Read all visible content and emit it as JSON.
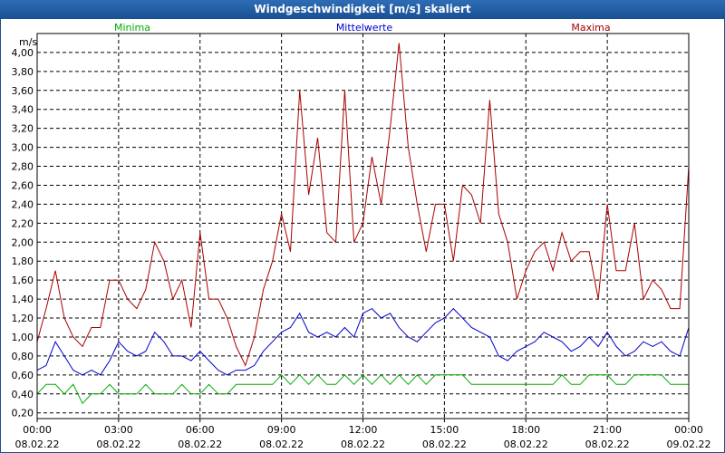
{
  "window": {
    "title": "Windgeschwindigkeit [m/s] skaliert"
  },
  "chart_data": {
    "type": "line",
    "title": "Windgeschwindigkeit [m/s] skaliert",
    "ylabel": "m/s",
    "ylim": [
      0.14,
      4.2
    ],
    "yticks": [
      "0,20",
      "0,40",
      "0,60",
      "0,80",
      "1,00",
      "1,20",
      "1,40",
      "1,60",
      "1,80",
      "2,00",
      "2,20",
      "2,40",
      "2,60",
      "2,80",
      "3,00",
      "3,20",
      "3,40",
      "3,60",
      "3,80",
      "4,00"
    ],
    "ytick_values": [
      0.2,
      0.4,
      0.6,
      0.8,
      1.0,
      1.2,
      1.4,
      1.6,
      1.8,
      2.0,
      2.2,
      2.4,
      2.6,
      2.8,
      3.0,
      3.2,
      3.4,
      3.6,
      3.8,
      4.0
    ],
    "xlim": [
      0,
      24
    ],
    "xticks": [
      {
        "x": 0,
        "time": "00:00",
        "date": "08.02.22"
      },
      {
        "x": 3,
        "time": "03:00",
        "date": "08.02.22"
      },
      {
        "x": 6,
        "time": "06:00",
        "date": "08.02.22"
      },
      {
        "x": 9,
        "time": "09:00",
        "date": "08.02.22"
      },
      {
        "x": 12,
        "time": "12:00",
        "date": "08.02.22"
      },
      {
        "x": 15,
        "time": "15:00",
        "date": "08.02.22"
      },
      {
        "x": 18,
        "time": "18:00",
        "date": "08.02.22"
      },
      {
        "x": 21,
        "time": "21:00",
        "date": "08.02.22"
      },
      {
        "x": 24,
        "time": "00:00",
        "date": "09.02.22"
      }
    ],
    "grid": true,
    "legend_position": "top",
    "series": [
      {
        "name": "Minima",
        "color": "#00aa00",
        "x": [
          0,
          0.33,
          0.67,
          1,
          1.33,
          1.67,
          2,
          2.33,
          2.67,
          3,
          3.33,
          3.67,
          4,
          4.33,
          4.67,
          5,
          5.33,
          5.67,
          6,
          6.33,
          6.67,
          7,
          7.33,
          7.67,
          8,
          8.33,
          8.67,
          9,
          9.33,
          9.67,
          10,
          10.33,
          10.67,
          11,
          11.33,
          11.67,
          12,
          12.33,
          12.67,
          13,
          13.33,
          13.67,
          14,
          14.33,
          14.67,
          15,
          15.33,
          15.67,
          16,
          16.33,
          16.67,
          17,
          17.33,
          17.67,
          18,
          18.33,
          18.67,
          19,
          19.33,
          19.67,
          20,
          20.33,
          20.67,
          21,
          21.33,
          21.67,
          22,
          22.33,
          22.67,
          23,
          23.33,
          23.67,
          24
        ],
        "values": [
          0.4,
          0.5,
          0.5,
          0.4,
          0.5,
          0.3,
          0.4,
          0.4,
          0.5,
          0.4,
          0.4,
          0.4,
          0.5,
          0.4,
          0.4,
          0.4,
          0.5,
          0.4,
          0.4,
          0.5,
          0.4,
          0.4,
          0.5,
          0.5,
          0.5,
          0.5,
          0.5,
          0.6,
          0.5,
          0.6,
          0.5,
          0.6,
          0.5,
          0.5,
          0.6,
          0.5,
          0.6,
          0.5,
          0.6,
          0.5,
          0.6,
          0.5,
          0.6,
          0.5,
          0.6,
          0.6,
          0.6,
          0.6,
          0.5,
          0.5,
          0.5,
          0.5,
          0.5,
          0.5,
          0.5,
          0.5,
          0.5,
          0.5,
          0.6,
          0.5,
          0.5,
          0.6,
          0.6,
          0.6,
          0.5,
          0.5,
          0.6,
          0.6,
          0.6,
          0.6,
          0.5,
          0.5,
          0.5
        ]
      },
      {
        "name": "Mittelwerte",
        "color": "#0000cc",
        "x": [
          0,
          0.33,
          0.67,
          1,
          1.33,
          1.67,
          2,
          2.33,
          2.67,
          3,
          3.33,
          3.67,
          4,
          4.33,
          4.67,
          5,
          5.33,
          5.67,
          6,
          6.33,
          6.67,
          7,
          7.33,
          7.67,
          8,
          8.33,
          8.67,
          9,
          9.33,
          9.67,
          10,
          10.33,
          10.67,
          11,
          11.33,
          11.67,
          12,
          12.33,
          12.67,
          13,
          13.33,
          13.67,
          14,
          14.33,
          14.67,
          15,
          15.33,
          15.67,
          16,
          16.33,
          16.67,
          17,
          17.33,
          17.67,
          18,
          18.33,
          18.67,
          19,
          19.33,
          19.67,
          20,
          20.33,
          20.67,
          21,
          21.33,
          21.67,
          22,
          22.33,
          22.67,
          23,
          23.33,
          23.67,
          24
        ],
        "values": [
          0.65,
          0.7,
          0.95,
          0.8,
          0.65,
          0.6,
          0.65,
          0.6,
          0.75,
          0.95,
          0.85,
          0.8,
          0.85,
          1.05,
          0.95,
          0.8,
          0.8,
          0.75,
          0.85,
          0.75,
          0.65,
          0.6,
          0.65,
          0.65,
          0.7,
          0.85,
          0.95,
          1.05,
          1.1,
          1.25,
          1.05,
          1.0,
          1.05,
          1.0,
          1.1,
          1.0,
          1.25,
          1.3,
          1.2,
          1.25,
          1.1,
          1.0,
          0.95,
          1.05,
          1.15,
          1.2,
          1.3,
          1.2,
          1.1,
          1.05,
          1.0,
          0.8,
          0.75,
          0.85,
          0.9,
          0.95,
          1.05,
          1.0,
          0.95,
          0.85,
          0.9,
          1.0,
          0.9,
          1.05,
          0.9,
          0.8,
          0.85,
          0.95,
          0.9,
          0.95,
          0.85,
          0.8,
          1.1
        ]
      },
      {
        "name": "Maxima",
        "color": "#aa0000",
        "x": [
          0,
          0.33,
          0.67,
          1,
          1.33,
          1.67,
          2,
          2.33,
          2.67,
          3,
          3.33,
          3.67,
          4,
          4.33,
          4.67,
          5,
          5.33,
          5.67,
          6,
          6.33,
          6.67,
          7,
          7.33,
          7.67,
          8,
          8.33,
          8.67,
          9,
          9.33,
          9.67,
          10,
          10.33,
          10.67,
          11,
          11.33,
          11.67,
          12,
          12.33,
          12.67,
          13,
          13.33,
          13.67,
          14,
          14.33,
          14.67,
          15,
          15.33,
          15.67,
          16,
          16.33,
          16.67,
          17,
          17.33,
          17.67,
          18,
          18.33,
          18.67,
          19,
          19.33,
          19.67,
          20,
          20.33,
          20.67,
          21,
          21.33,
          21.67,
          22,
          22.33,
          22.67,
          23,
          23.33,
          23.67,
          24
        ],
        "values": [
          0.95,
          1.3,
          1.7,
          1.2,
          1.0,
          0.9,
          1.1,
          1.1,
          1.6,
          1.6,
          1.4,
          1.3,
          1.5,
          2.0,
          1.8,
          1.4,
          1.6,
          1.1,
          2.1,
          1.4,
          1.4,
          1.2,
          0.9,
          0.7,
          1.0,
          1.5,
          1.8,
          2.3,
          1.9,
          3.6,
          2.5,
          3.1,
          2.1,
          2.0,
          3.6,
          2.0,
          2.2,
          2.9,
          2.4,
          3.2,
          4.1,
          3.0,
          2.4,
          1.9,
          2.4,
          2.4,
          1.8,
          2.6,
          2.5,
          2.2,
          3.5,
          2.3,
          2.0,
          1.4,
          1.7,
          1.9,
          2.0,
          1.7,
          2.1,
          1.8,
          1.9,
          1.9,
          1.4,
          2.4,
          1.7,
          1.7,
          2.2,
          1.4,
          1.6,
          1.5,
          1.3,
          1.3,
          2.8
        ]
      }
    ]
  }
}
